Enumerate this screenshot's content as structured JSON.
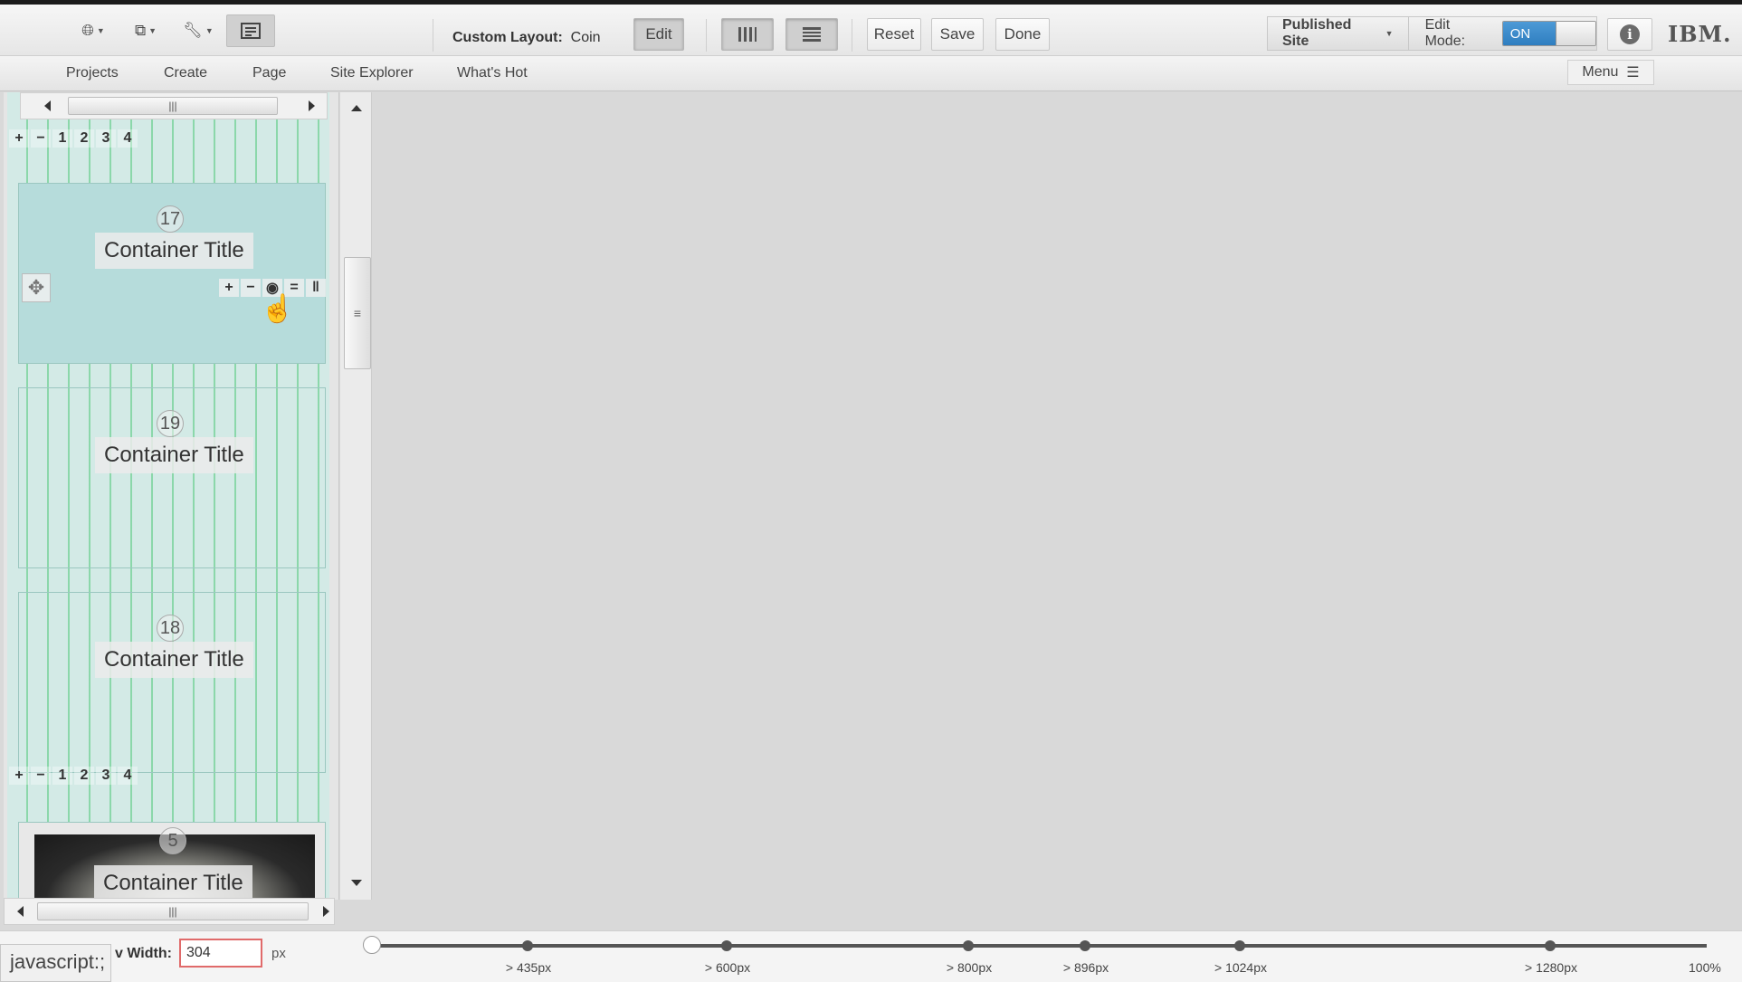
{
  "toolbar": {
    "layout_label": "Custom Layout:",
    "layout_name": "Coin",
    "edit_label": "Edit",
    "reset_label": "Reset",
    "save_label": "Save",
    "done_label": "Done",
    "published_site_label": "Published Site",
    "edit_mode_label": "Edit Mode:",
    "edit_mode_value": "ON",
    "logo": "IBM."
  },
  "nav": {
    "items": [
      "Projects",
      "Create",
      "Page",
      "Site Explorer",
      "What's Hot"
    ],
    "menu_label": "Menu"
  },
  "panel": {
    "column_buttons": [
      "1",
      "2",
      "3",
      "4"
    ],
    "containers": [
      {
        "number": "17",
        "title": "Container Title"
      },
      {
        "number": "19",
        "title": "Container Title"
      },
      {
        "number": "18",
        "title": "Container Title"
      },
      {
        "number": "5",
        "title": "Container Title"
      }
    ]
  },
  "bottom": {
    "status_text": "javascript:;",
    "width_label": "v Width:",
    "width_value": "304",
    "width_unit": "px",
    "breakpoints": [
      "> 435px",
      "> 600px",
      "> 800px",
      "> 896px",
      "> 1024px",
      "> 1280px"
    ],
    "percent_label": "100%"
  },
  "icons": [
    "globe-icon",
    "device-icon",
    "wrench-icon",
    "layout-icon",
    "columns-icon",
    "rows-icon",
    "info-icon",
    "menu-icon",
    "move-icon",
    "plus-icon",
    "minus-icon",
    "eye-icon",
    "equals-icon",
    "pause-icon",
    "hand-cursor-icon"
  ],
  "colors": {
    "accent": "#3a8bd0",
    "grid_line": "#50c878",
    "container_active": "#b6dcdb",
    "input_border": "#e06a6a"
  }
}
